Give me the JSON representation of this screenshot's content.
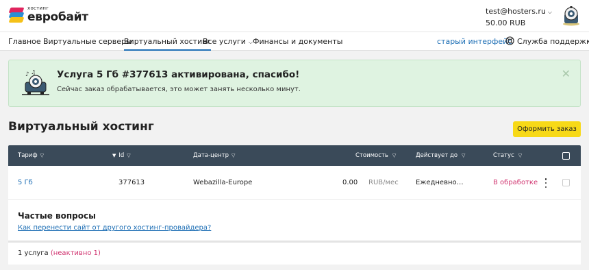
{
  "brand": {
    "small": "хостинг",
    "name": "евробайт"
  },
  "account": {
    "email": "test@hosters.ru",
    "balance": "50.00 RUB"
  },
  "nav": {
    "items": [
      {
        "label": "Главное"
      },
      {
        "label": "Виртуальные серверы"
      },
      {
        "label": "Виртуальный хостинг",
        "active": true
      },
      {
        "label": "Все услуги"
      },
      {
        "label": "Финансы и документы"
      }
    ],
    "old_interface": "старый интерфейс",
    "support": "Служба поддержки"
  },
  "notice": {
    "title": "Услуга 5 Гб #377613 активирована, спасибо!",
    "subtitle": "Сейчас заказ обрабатывается, это может занять несколько минут.",
    "close": "✕"
  },
  "page": {
    "title": "Виртуальный хостинг",
    "order_button": "Оформить заказ"
  },
  "table": {
    "headers": {
      "tariff": "Тариф",
      "id": "Id",
      "datacenter": "Дата-центр",
      "cost": "Стоимость",
      "valid_until": "Действует до",
      "status": "Статус"
    },
    "rows": [
      {
        "tariff": "5 Гб",
        "id": "377613",
        "datacenter": "Webazilla-Europe",
        "cost": "0.00",
        "cost_unit": "RUB/мес",
        "valid_until": "Ежедневно…",
        "status": "В обработке"
      }
    ]
  },
  "faq": {
    "title": "Частые вопросы",
    "link": "Как перенести сайт от другого хостинг-провайдера?"
  },
  "footer": {
    "count": "1 услуга",
    "inactive": "(неактивно 1)"
  },
  "colors": {
    "accent": "#1e6fb5",
    "header_dark": "#3a4a59",
    "button": "#f7d917",
    "status": "#d0336f",
    "notice_bg": "#dff3e1"
  }
}
